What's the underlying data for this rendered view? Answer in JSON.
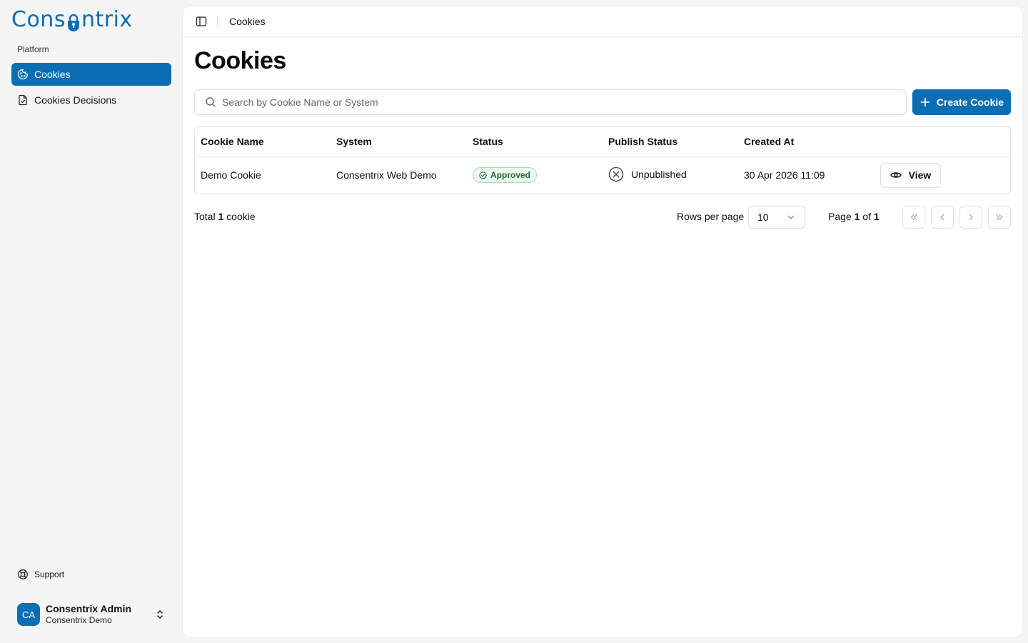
{
  "brand": {
    "logo_text_start": "Cons",
    "logo_text_end": "ntrix",
    "accent_color": "#0a6eb4"
  },
  "sidebar": {
    "section_label": "Platform",
    "items": [
      {
        "label": "Cookies",
        "icon": "cookie-icon",
        "active": true
      },
      {
        "label": "Cookies Decisions",
        "icon": "file-check-icon",
        "active": false
      }
    ],
    "support_label": "Support",
    "user": {
      "initials": "CA",
      "name": "Consentrix Admin",
      "org": "Consentrix Demo"
    }
  },
  "topbar": {
    "breadcrumb": "Cookies"
  },
  "page": {
    "title": "Cookies",
    "search_placeholder": "Search by Cookie Name or System",
    "create_label": "Create Cookie"
  },
  "table": {
    "columns": [
      "Cookie Name",
      "System",
      "Status",
      "Publish Status",
      "Created At",
      ""
    ],
    "rows": [
      {
        "cookie_name": "Demo Cookie",
        "system": "Consentrix Web Demo",
        "status": "Approved",
        "publish_status": "Unpublished",
        "created_at": "30 Apr 2026 11:09",
        "action_label": "View"
      }
    ]
  },
  "pagination": {
    "total_prefix": "Total",
    "total_count": "1",
    "total_suffix": "cookie",
    "rows_per_page_label": "Rows per page",
    "rows_per_page_value": "10",
    "page_prefix": "Page",
    "current_page": "1",
    "page_of": "of",
    "total_pages": "1"
  }
}
